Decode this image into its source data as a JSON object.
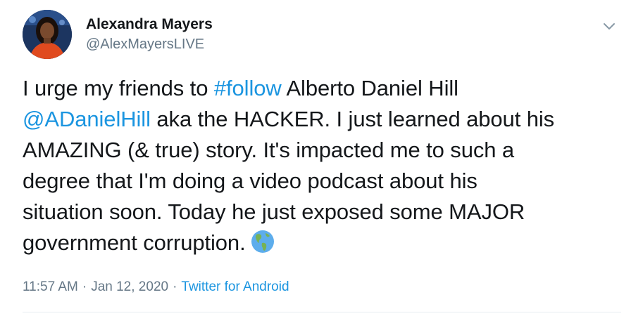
{
  "author": {
    "display_name": "Alexandra Mayers",
    "handle": "@AlexMayersLIVE"
  },
  "tweet": {
    "line1": {
      "pre": "I urge my friends to ",
      "hashtag": "#follow",
      "post": " Alberto Daniel Hill"
    },
    "line2": {
      "mention": "@ADanielHill",
      "post": " aka the HACKER. I just learned about his"
    },
    "line3": "AMAZING (& true) story. It's impacted me to such a",
    "line4": "degree that I'm doing a video podcast about his",
    "line5": "situation soon. Today he just exposed some MAJOR",
    "line6": "government corruption.",
    "emoji": "globe-americas-icon"
  },
  "meta": {
    "time": "11:57 AM",
    "separator": "·",
    "date": "Jan 12, 2020",
    "source": "Twitter for Android"
  },
  "colors": {
    "link": "#1b95e0",
    "text": "#14171a",
    "secondary": "#657786",
    "divider": "#e6ecf0"
  }
}
